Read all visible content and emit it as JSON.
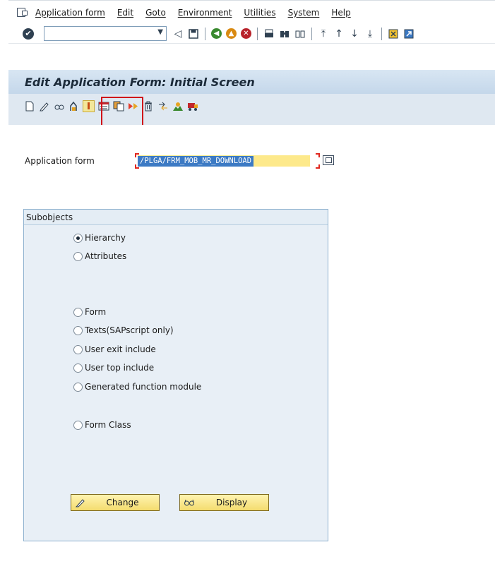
{
  "menu": {
    "items": [
      "Application form",
      "Edit",
      "Goto",
      "Environment",
      "Utilities",
      "System",
      "Help"
    ]
  },
  "toolbar": {
    "command_field": ""
  },
  "title": "Edit Application Form: Initial Screen",
  "app_toolbar": {
    "icons": [
      "create-icon",
      "change-icon",
      "display-icon",
      "check-icon",
      "activate-icon",
      "test-icon",
      "copy-icon",
      "where-used-icon",
      "delete-icon",
      "transport-icon",
      "other-object-icon",
      "print-icon"
    ]
  },
  "form": {
    "application_form_label": "Application form",
    "application_form_value": "/PLGA/FRM_MOB_MR_DOWNLOAD"
  },
  "subobjects": {
    "title": "Subobjects",
    "options": [
      {
        "label": "Hierarchy",
        "selected": true
      },
      {
        "label": "Attributes",
        "selected": false
      },
      {
        "label": "Form",
        "selected": false
      },
      {
        "label": "Texts(SAPscript only)",
        "selected": false
      },
      {
        "label": "User exit include",
        "selected": false
      },
      {
        "label": "User top include",
        "selected": false
      },
      {
        "label": "Generated function module",
        "selected": false
      },
      {
        "label": "Form Class",
        "selected": false
      }
    ],
    "change_label": "Change",
    "display_label": "Display"
  },
  "colors": {
    "title_bar": "#c4d7ea",
    "highlight": "#d0101a",
    "field_bg": "#fde98b",
    "button_bg": "#f4dc6e"
  }
}
